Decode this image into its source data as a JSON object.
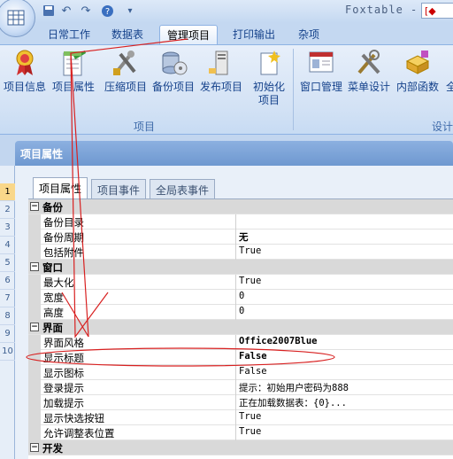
{
  "window": {
    "title": "Foxtable -",
    "title_box": "[◆"
  },
  "quick_access": [
    "save-icon",
    "undo-icon",
    "redo-icon",
    "help-icon",
    "dropdown-icon"
  ],
  "tabs": [
    "日常工作",
    "数据表",
    "管理项目",
    "打印输出",
    "杂项"
  ],
  "active_tab": "管理项目",
  "ribbon": {
    "buttons": [
      {
        "label": "项目信息",
        "icon": "award-icon"
      },
      {
        "label": "项目属性",
        "icon": "document-edit-icon"
      },
      {
        "label": "压缩项目",
        "icon": "compress-tools-icon"
      },
      {
        "label": "备份项目",
        "icon": "backup-disk-icon"
      },
      {
        "label": "发布项目",
        "icon": "publish-computer-icon"
      },
      {
        "label": "初始化",
        "label2": "项目",
        "icon": "initialize-icon"
      },
      {
        "label": "窗口管理",
        "icon": "window-icon"
      },
      {
        "label": "菜单设计",
        "icon": "menu-tools-icon"
      },
      {
        "label": "内部函数",
        "icon": "function-icon"
      },
      {
        "label": "全",
        "icon": "global-icon"
      }
    ],
    "groups": [
      "项目",
      "设计"
    ]
  },
  "panel": {
    "title": "项目属性",
    "tabs": [
      "项目属性",
      "项目事件",
      "全局表事件"
    ],
    "active_tab": "项目属性"
  },
  "row_headers": [
    "1",
    "2",
    "3",
    "4",
    "5",
    "6",
    "7",
    "8",
    "9",
    "10"
  ],
  "property_grid": [
    {
      "category": "备份",
      "toggle": "−"
    },
    {
      "key": "备份目录",
      "value": ""
    },
    {
      "key": "备份周期",
      "value": "无",
      "bold": true
    },
    {
      "key": "包括附件",
      "value": "True"
    },
    {
      "category": "窗口",
      "toggle": "−"
    },
    {
      "key": "最大化",
      "value": "True"
    },
    {
      "key": "宽度",
      "value": "0"
    },
    {
      "key": "高度",
      "value": "0"
    },
    {
      "category": "界面",
      "toggle": "−"
    },
    {
      "key": "界面风格",
      "value": "Office2007Blue",
      "bold": true
    },
    {
      "key": "显示标题",
      "value": "False",
      "bold": true
    },
    {
      "key": "显示图标",
      "value": "False"
    },
    {
      "key": "登录提示",
      "value": "提示：初始用户密码为888"
    },
    {
      "key": "加载提示",
      "value": "正在加载数据表：{0}..."
    },
    {
      "key": "显示快选按钮",
      "value": "True"
    },
    {
      "key": "允许调整表位置",
      "value": "True"
    },
    {
      "category": "开发",
      "toggle": "−"
    }
  ],
  "colors": {
    "accent": "#d82020",
    "ribbon_text": "#15428b",
    "panel_title": "#7ba1d6"
  }
}
